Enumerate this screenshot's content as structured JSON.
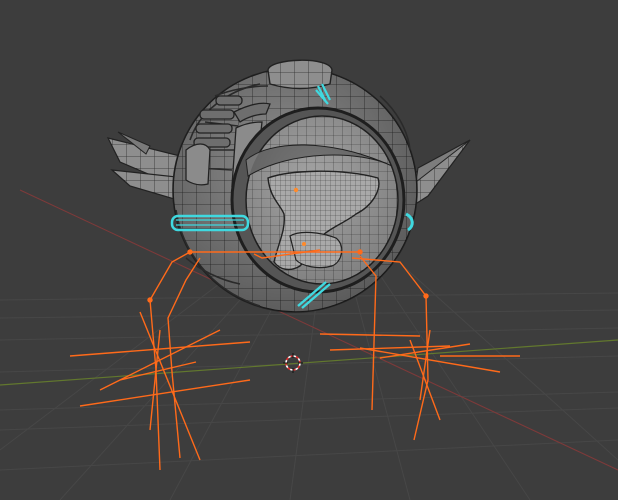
{
  "viewport": {
    "background": "#3d3d3d",
    "grid_color": "#4a4a4a",
    "x_axis_color": "#8a3a3a",
    "y_axis_color": "#5f7a2c"
  },
  "model": {
    "object": "sphere-robot-mesh",
    "mesh_fill": "#9a9a9a",
    "wire_color": "#2a2a2a",
    "selected_color": "#3fd9e0",
    "armature_color": "#ff6a1a"
  },
  "icons": {
    "origin": "3d-cursor-icon"
  }
}
